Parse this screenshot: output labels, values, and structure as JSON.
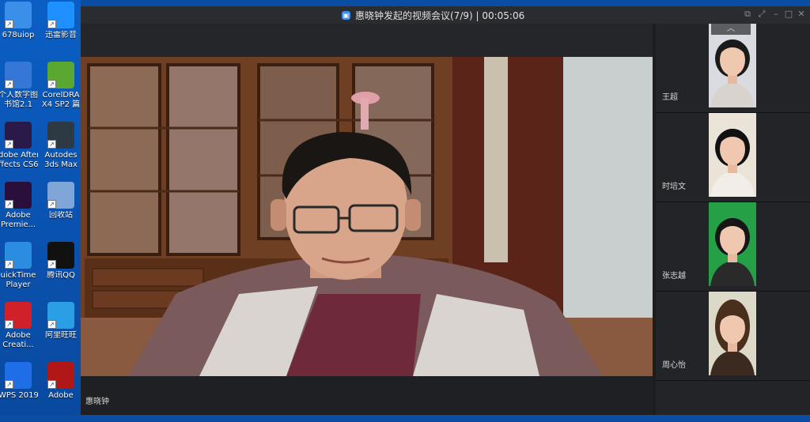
{
  "desktop": {
    "icons": [
      {
        "label": "678uiop",
        "icon": "computer-icon",
        "color": "#3a8fe8"
      },
      {
        "label": "迅雷影音",
        "icon": "xunlei-icon",
        "color": "#1e90ff"
      },
      {
        "label": "个人数字图\n书馆2.1",
        "icon": "library-icon",
        "color": "#3577d6"
      },
      {
        "label": "CorelDRA\nX4 SP2 篇",
        "icon": "coreldraw-icon",
        "color": "#5aa832"
      },
      {
        "label": "dobe After\nffects CS6",
        "icon": "after-effects-icon",
        "color": "#2a1a4a"
      },
      {
        "label": "Autodes\n3ds Max",
        "icon": "3dsmax-icon",
        "color": "#2d3a44"
      },
      {
        "label": "Adobe\nPremie...",
        "icon": "premiere-icon",
        "color": "#2a0f3d"
      },
      {
        "label": "回收站",
        "icon": "recycle-bin-icon",
        "color": "#7fa6d6"
      },
      {
        "label": "uickTime\nPlayer",
        "icon": "quicktime-icon",
        "color": "#2a8de0"
      },
      {
        "label": "腾讯QQ",
        "icon": "qq-icon",
        "color": "#111111"
      },
      {
        "label": "Adobe\nCreati...",
        "icon": "creative-cloud-icon",
        "color": "#d0202a"
      },
      {
        "label": "阿里旺旺",
        "icon": "aliwangwang-icon",
        "color": "#2a9fe6"
      },
      {
        "label": "WPS 2019",
        "icon": "wps-icon",
        "color": "#1f6ee8"
      },
      {
        "label": "Adobe",
        "icon": "acrobat-icon",
        "color": "#b01818"
      }
    ]
  },
  "window": {
    "title": "惠晓钟发起的视频会议(7/9) | 00:05:06",
    "controls": [
      "pin-icon",
      "fullscreen-icon",
      "minimize-icon",
      "maximize-icon",
      "close-icon"
    ]
  },
  "main_video": {
    "speaker_name": "惠晓钟",
    "next_symbol": "›"
  },
  "participants": {
    "scroll_up_symbol": "︿",
    "list": [
      {
        "name": "王超",
        "bg": "#d9dbe0",
        "shirt": "#d8d3cc",
        "hair": "#1a1a1a"
      },
      {
        "name": "时培文",
        "bg": "#e9e3d8",
        "shirt": "#f1eee9",
        "hair": "#111111"
      },
      {
        "name": "张志越",
        "bg": "#25a046",
        "shirt": "#2a2a2a",
        "hair": "#161616"
      },
      {
        "name": "周心怡",
        "bg": "#ddd9c8",
        "shirt": "#3b2a1f",
        "hair": "#4a2f1d"
      }
    ]
  }
}
